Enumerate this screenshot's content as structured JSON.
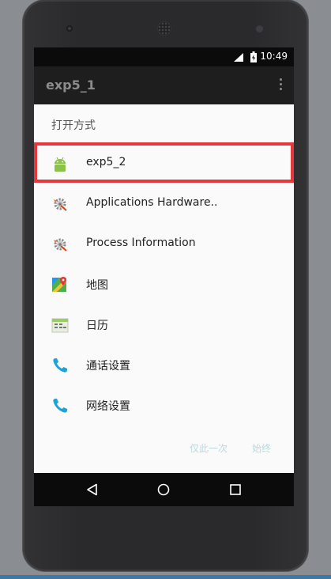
{
  "status": {
    "time": "10:49"
  },
  "app": {
    "title": "exp5_1"
  },
  "dialog": {
    "title": "打开方式",
    "items": [
      {
        "label": "exp5_2",
        "icon": "android-icon"
      },
      {
        "label": "Applications Hardware..",
        "icon": "settings-gear-icon"
      },
      {
        "label": "Process Information",
        "icon": "settings-gear-icon"
      },
      {
        "label": "地图",
        "icon": "maps-icon"
      },
      {
        "label": "日历",
        "icon": "calendar-icon"
      },
      {
        "label": "通话设置",
        "icon": "phone-icon"
      },
      {
        "label": "网络设置",
        "icon": "phone-icon"
      }
    ],
    "actions": {
      "once": "仅此一次",
      "always": "始终"
    }
  },
  "colors": {
    "highlight": "#e5383b",
    "android": "#8bc34a",
    "phone": "#1fa1d9"
  }
}
